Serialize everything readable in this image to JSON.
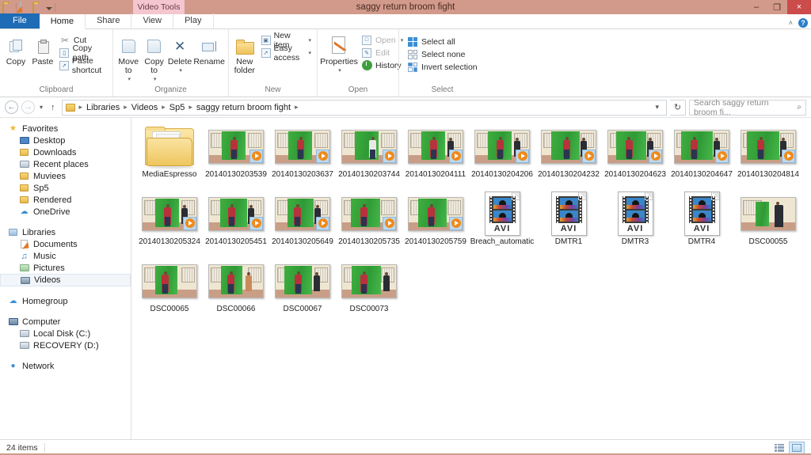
{
  "window": {
    "title": "saggy return broom fight",
    "contextual_tab_group": "Video Tools",
    "minimize": "–",
    "maximize": "❐",
    "close": "×",
    "quick_access": [
      "folder-icon",
      "save-icon",
      "folder-properties-icon",
      "dropdown-caret"
    ]
  },
  "ribbon": {
    "tabs": [
      {
        "label": "File",
        "state": "file"
      },
      {
        "label": "Home",
        "state": "active"
      },
      {
        "label": "Share",
        "state": "normal"
      },
      {
        "label": "View",
        "state": "normal"
      },
      {
        "label": "Play",
        "state": "normal"
      }
    ],
    "collapse_icon": "˄",
    "help_icon": "?",
    "groups": [
      {
        "name": "Clipboard",
        "big_buttons": [
          {
            "label": "Copy",
            "icon": "copy-icon"
          },
          {
            "label": "Paste",
            "icon": "paste-icon"
          }
        ],
        "small_buttons": [
          {
            "label": "Cut",
            "icon": "scissors-icon"
          },
          {
            "label": "Copy path",
            "icon": "copy-path-icon"
          },
          {
            "label": "Paste shortcut",
            "icon": "paste-shortcut-icon"
          }
        ]
      },
      {
        "name": "Organize",
        "big_buttons": [
          {
            "label": "Move to",
            "icon": "move-to-icon",
            "caret": true
          },
          {
            "label": "Copy to",
            "icon": "copy-to-icon",
            "caret": true
          },
          {
            "label": "Delete",
            "icon": "delete-icon",
            "caret": true
          },
          {
            "label": "Rename",
            "icon": "rename-icon",
            "caret": false
          }
        ]
      },
      {
        "name": "New",
        "big_buttons": [
          {
            "label": "New folder",
            "icon": "new-folder-icon"
          }
        ],
        "small_buttons": [
          {
            "label": "New item",
            "icon": "new-item-icon",
            "caret": true
          },
          {
            "label": "Easy access",
            "icon": "easy-access-icon",
            "caret": true
          }
        ]
      },
      {
        "name": "Open",
        "big_buttons": [
          {
            "label": "Properties",
            "icon": "properties-icon",
            "caret": true
          }
        ],
        "small_buttons": [
          {
            "label": "Open",
            "icon": "open-icon",
            "caret": true,
            "disabled": true
          },
          {
            "label": "Edit",
            "icon": "edit-icon",
            "disabled": true
          },
          {
            "label": "History",
            "icon": "history-icon",
            "disabled": false
          }
        ]
      },
      {
        "name": "Select",
        "small_buttons": [
          {
            "label": "Select all",
            "icon": "select-all-icon"
          },
          {
            "label": "Select none",
            "icon": "select-none-icon"
          },
          {
            "label": "Invert selection",
            "icon": "invert-selection-icon"
          }
        ]
      }
    ]
  },
  "address_bar": {
    "back_icon": "←",
    "forward_icon": "→",
    "recent_caret": "▾",
    "up_icon": "↑",
    "breadcrumbs": [
      "Libraries",
      "Videos",
      "Sp5",
      "saggy return broom fight"
    ],
    "separator": "▸",
    "dropdown_caret": "▾",
    "refresh_icon": "↻",
    "search_placeholder": "Search saggy return broom fi...",
    "search_value": "",
    "search_icon": "⌕"
  },
  "navigation_pane": {
    "sections": [
      {
        "header": {
          "label": "Favorites",
          "icon": "star-icon"
        },
        "items": [
          {
            "label": "Desktop",
            "icon": "desktop-icon"
          },
          {
            "label": "Downloads",
            "icon": "downloads-icon"
          },
          {
            "label": "Recent places",
            "icon": "recent-places-icon"
          },
          {
            "label": "Muviees",
            "icon": "folder-icon"
          },
          {
            "label": "Sp5",
            "icon": "folder-icon"
          },
          {
            "label": "Rendered",
            "icon": "folder-icon"
          },
          {
            "label": "OneDrive",
            "icon": "onedrive-icon"
          }
        ]
      },
      {
        "header": {
          "label": "Libraries",
          "icon": "libraries-icon"
        },
        "items": [
          {
            "label": "Documents",
            "icon": "documents-icon"
          },
          {
            "label": "Music",
            "icon": "music-icon"
          },
          {
            "label": "Pictures",
            "icon": "pictures-icon"
          },
          {
            "label": "Videos",
            "icon": "videos-icon",
            "selected": true
          }
        ]
      },
      {
        "header": {
          "label": "Homegroup",
          "icon": "homegroup-icon"
        },
        "items": []
      },
      {
        "header": {
          "label": "Computer",
          "icon": "computer-icon"
        },
        "items": [
          {
            "label": "Local Disk (C:)",
            "icon": "hard-disk-icon"
          },
          {
            "label": "RECOVERY (D:)",
            "icon": "hard-disk-icon"
          }
        ]
      },
      {
        "header": {
          "label": "Network",
          "icon": "network-icon"
        },
        "items": []
      }
    ]
  },
  "file_grid": {
    "items": [
      {
        "name": "MediaEspresso",
        "type": "folder"
      },
      {
        "name": "20140130203539",
        "type": "video"
      },
      {
        "name": "20140130203637",
        "type": "video"
      },
      {
        "name": "20140130203744",
        "type": "video"
      },
      {
        "name": "20140130204111",
        "type": "video"
      },
      {
        "name": "20140130204206",
        "type": "video"
      },
      {
        "name": "20140130204232",
        "type": "video"
      },
      {
        "name": "20140130204623",
        "type": "video"
      },
      {
        "name": "20140130204647",
        "type": "video"
      },
      {
        "name": "20140130204814",
        "type": "video"
      },
      {
        "name": "20140130205324",
        "type": "video"
      },
      {
        "name": "20140130205451",
        "type": "video"
      },
      {
        "name": "20140130205649",
        "type": "video"
      },
      {
        "name": "20140130205735",
        "type": "video"
      },
      {
        "name": "20140130205759",
        "type": "video"
      },
      {
        "name": "Breach_automatic",
        "type": "avi",
        "badge": "AVI"
      },
      {
        "name": "DMTR1",
        "type": "avi",
        "badge": "AVI"
      },
      {
        "name": "DMTR3",
        "type": "avi",
        "badge": "AVI"
      },
      {
        "name": "DMTR4",
        "type": "avi",
        "badge": "AVI"
      },
      {
        "name": "DSC00055",
        "type": "photo"
      },
      {
        "name": "DSC00065",
        "type": "photo"
      },
      {
        "name": "DSC00066",
        "type": "photo"
      },
      {
        "name": "DSC00067",
        "type": "photo"
      },
      {
        "name": "DSC00073",
        "type": "photo"
      }
    ]
  },
  "status_bar": {
    "item_count": "24 items",
    "view_buttons": [
      {
        "name": "details-view",
        "active": false
      },
      {
        "name": "large-icons-view",
        "active": true
      }
    ]
  },
  "colors": {
    "titlebar": "#d19a8b",
    "contextual_tab": "#f3c6d0",
    "file_tab": "#1e6cb5",
    "close_button": "#cc4b4b",
    "selection": "#f2f6fb",
    "greenscreen": "#35a83a",
    "play_badge": "#f08a1a"
  }
}
